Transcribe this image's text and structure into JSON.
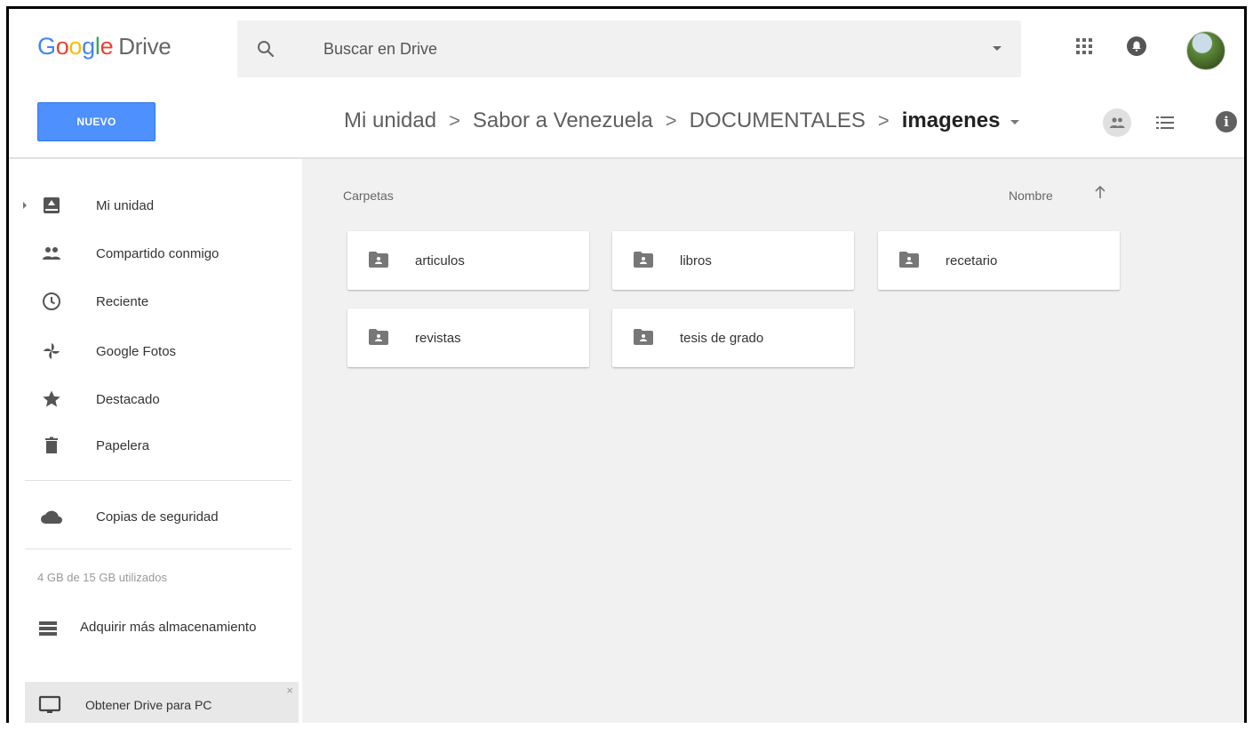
{
  "header": {
    "logo_google": "Google",
    "logo_product": "Drive",
    "search_placeholder": "Buscar en Drive"
  },
  "toolbar": {
    "new_label": "NUEVO",
    "breadcrumb": [
      "Mi unidad",
      "Sabor a Venezuela",
      "DOCUMENTALES",
      "imagenes"
    ],
    "separator": ">"
  },
  "sidebar": {
    "items": [
      {
        "label": "Mi unidad",
        "icon": "drive-icon"
      },
      {
        "label": "Compartido conmigo",
        "icon": "people-icon"
      },
      {
        "label": "Reciente",
        "icon": "clock-icon"
      },
      {
        "label": "Google Fotos",
        "icon": "pinwheel-icon"
      },
      {
        "label": "Destacado",
        "icon": "star-icon"
      },
      {
        "label": "Papelera",
        "icon": "trash-icon"
      }
    ],
    "backup_label": "Copias de seguridad",
    "storage_text": "4 GB de 15 GB utilizados",
    "buy_storage_label": "Adquirir más almacenamiento",
    "get_drive_label": "Obtener Drive para PC",
    "get_drive_close": "×"
  },
  "main": {
    "section_label": "Carpetas",
    "sort_label": "Nombre",
    "folders": [
      {
        "name": "articulos"
      },
      {
        "name": "libros"
      },
      {
        "name": "recetario"
      },
      {
        "name": "revistas"
      },
      {
        "name": "tesis de grado"
      }
    ]
  },
  "colors": {
    "accent": "#4d90fe",
    "main_background": "#f1f1f1",
    "icon_gray": "#616161"
  }
}
